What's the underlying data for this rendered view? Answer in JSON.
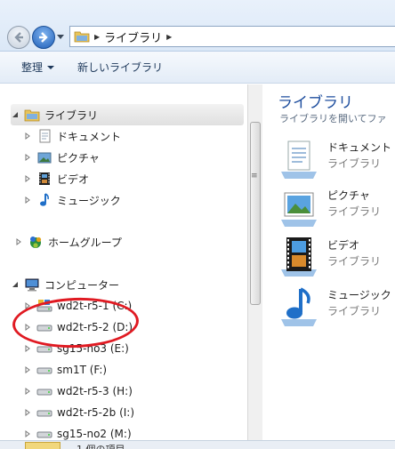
{
  "address": {
    "crumbs": [
      "ライブラリ"
    ]
  },
  "toolbar": {
    "organize": "整理",
    "new_library": "新しいライブラリ"
  },
  "tree": {
    "libraries": "ライブラリ",
    "documents": "ドキュメント",
    "pictures": "ピクチャ",
    "videos": "ビデオ",
    "music": "ミュージック",
    "homegroup": "ホームグループ",
    "computer": "コンピューター",
    "drives": [
      "wd2t-r5-1 (C:)",
      "wd2t-r5-2 (D:)",
      "sg15-no3 (E:)",
      "sm1T (F:)",
      "wd2t-r5-3 (H:)",
      "wd2t-r5-2b (I:)",
      "sg15-no2 (M:)"
    ]
  },
  "content": {
    "title": "ライブラリ",
    "subtitle": "ライブラリを開いてファ",
    "items": [
      {
        "name": "ドキュメント",
        "type": "ライブラリ",
        "icon": "documents-library-icon"
      },
      {
        "name": "ピクチャ",
        "type": "ライブラリ",
        "icon": "pictures-library-icon"
      },
      {
        "name": "ビデオ",
        "type": "ライブラリ",
        "icon": "videos-library-icon"
      },
      {
        "name": "ミュージック",
        "type": "ライブラリ",
        "icon": "music-library-icon"
      }
    ]
  },
  "status": {
    "text": "1 個の項目"
  },
  "colors": {
    "annotation_circle": "#e01a22",
    "title_blue": "#1e4e9e"
  }
}
